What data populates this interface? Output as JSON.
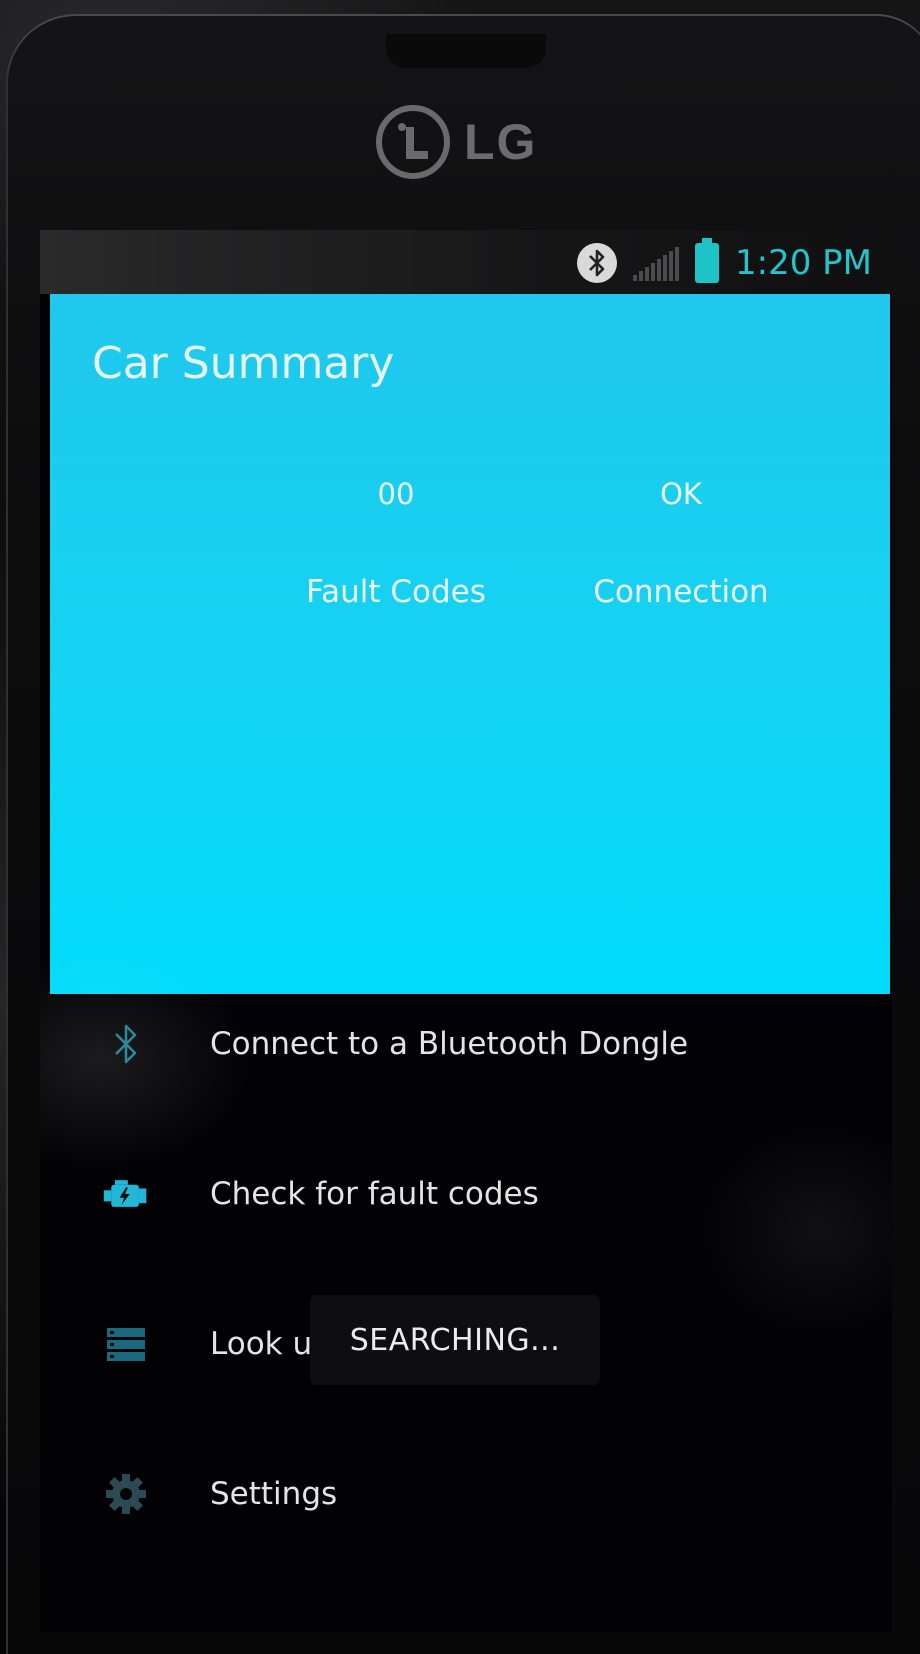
{
  "device": {
    "brand": "LG"
  },
  "status_bar": {
    "time": "1:20 PM",
    "icons": [
      "bluetooth-icon",
      "signal-icon",
      "battery-icon"
    ],
    "accent_color": "#23c4ce"
  },
  "summary_card": {
    "title": "Car Summary",
    "background_color": "#16d2f2",
    "stats": [
      {
        "value": "00",
        "label": "Fault Codes"
      },
      {
        "value": "OK",
        "label": "Connection"
      }
    ]
  },
  "menu": {
    "items": [
      {
        "label": "Connect to a Bluetooth Dongle",
        "icon": "bluetooth-icon"
      },
      {
        "label": "Check for fault codes",
        "icon": "engine-icon"
      },
      {
        "label": "Look u",
        "icon": "list-icon"
      },
      {
        "label": "Settings",
        "icon": "gear-icon"
      }
    ]
  },
  "toast": {
    "text": "SEARCHING..."
  }
}
